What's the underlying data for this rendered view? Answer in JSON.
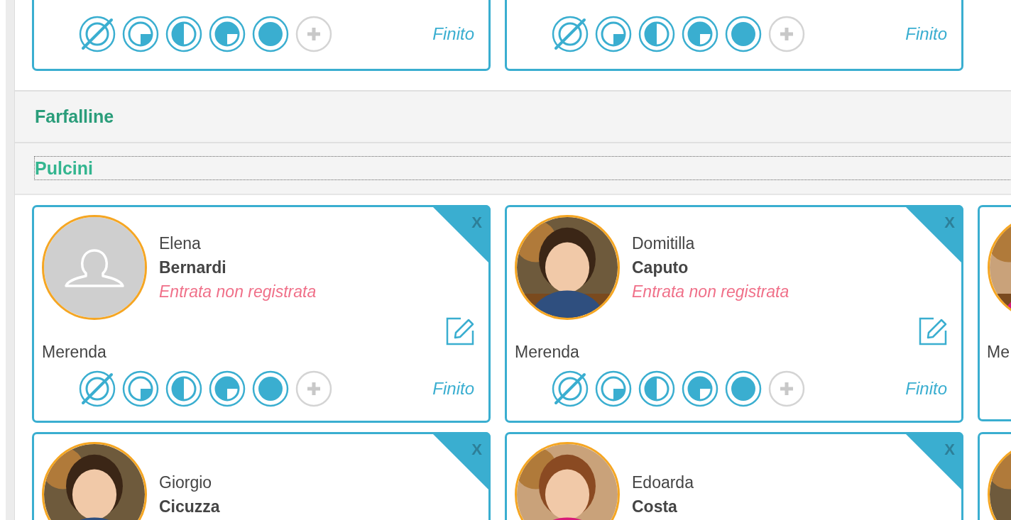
{
  "sections": [
    {
      "kind": "cards",
      "cards": [
        {
          "kind": "meal-only",
          "finish": "Finito"
        },
        {
          "kind": "meal-only",
          "finish": "Finito"
        }
      ]
    },
    {
      "kind": "header",
      "title": "Farfalline",
      "focused": false
    },
    {
      "kind": "header",
      "title": "Pulcini",
      "focused": true
    },
    {
      "kind": "cards",
      "cards": [
        {
          "kind": "full",
          "first_name": "Elena",
          "last_name": "Bernardi",
          "status": "Entrata non registrata",
          "meal": "Merenda",
          "finish": "Finito",
          "close": "X",
          "photo": false
        },
        {
          "kind": "full",
          "first_name": "Domitilla",
          "last_name": "Caputo",
          "status": "Entrata non registrata",
          "meal": "Merenda",
          "finish": "Finito",
          "close": "X",
          "photo": true
        },
        {
          "kind": "peek",
          "meal": "Me",
          "photo": true
        }
      ]
    },
    {
      "kind": "cards",
      "cards": [
        {
          "kind": "head",
          "first_name": "Giorgio",
          "last_name": "Cicuzza",
          "close": "X",
          "photo": true
        },
        {
          "kind": "head",
          "first_name": "Edoarda",
          "last_name": "Costa",
          "close": "X",
          "photo": true
        },
        {
          "kind": "peek",
          "photo": true
        }
      ]
    }
  ]
}
